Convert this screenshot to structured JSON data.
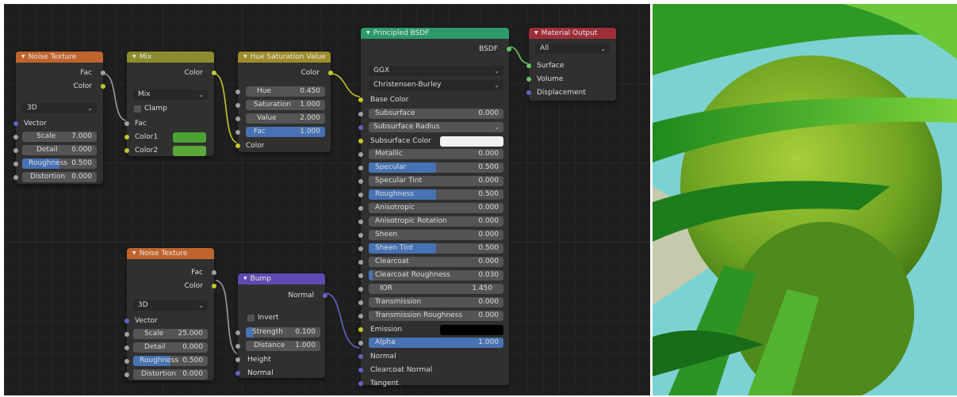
{
  "noise1": {
    "title": "Noise Texture",
    "out_fac": "Fac",
    "out_color": "Color",
    "dimensions": "3D",
    "in_vector": "Vector",
    "scale": {
      "label": "Scale",
      "value": "7.000"
    },
    "detail": {
      "label": "Detail",
      "value": "0.000"
    },
    "roughness": {
      "label": "Roughness",
      "value": "0.500",
      "fraction": 0.5
    },
    "distortion": {
      "label": "Distortion",
      "value": "0.000"
    }
  },
  "mix": {
    "title": "Mix",
    "out_color": "Color",
    "blend": "Mix",
    "clamp": "Clamp",
    "in_fac": "Fac",
    "color1": "Color1",
    "color2": "Color2",
    "color1_hex": "#4aa332",
    "color2_hex": "#5aa83a"
  },
  "hsv": {
    "title": "Hue Saturation Value",
    "out_color": "Color",
    "hue": {
      "label": "Hue",
      "value": "0.450"
    },
    "saturation": {
      "label": "Saturation",
      "value": "1.000"
    },
    "value": {
      "label": "Value",
      "value": "2.000"
    },
    "fac": {
      "label": "Fac",
      "value": "1.000",
      "fraction": 1.0
    },
    "in_color": "Color"
  },
  "bsdf": {
    "title": "Principled BSDF",
    "out_bsdf": "BSDF",
    "distribution": "GGX",
    "subsurface_method": "Christensen-Burley",
    "base_color": "Base Color",
    "subsurface": {
      "label": "Subsurface",
      "value": "0.000"
    },
    "subsurface_radius": "Subsurface Radius",
    "subsurface_color": "Subsurface Color",
    "metallic": {
      "label": "Metallic",
      "value": "0.000"
    },
    "specular": {
      "label": "Specular",
      "value": "0.500",
      "fraction": 0.5
    },
    "specular_tint": {
      "label": "Specular Tint",
      "value": "0.000"
    },
    "roughness": {
      "label": "Roughness",
      "value": "0.500",
      "fraction": 0.5
    },
    "anisotropic": {
      "label": "Anisotropic",
      "value": "0.000"
    },
    "anisotropic_rotation": {
      "label": "Anisotropic Rotation",
      "value": "0.000"
    },
    "sheen": {
      "label": "Sheen",
      "value": "0.000"
    },
    "sheen_tint": {
      "label": "Sheen Tint",
      "value": "0.500",
      "fraction": 0.5
    },
    "clearcoat": {
      "label": "Clearcoat",
      "value": "0.000"
    },
    "clearcoat_roughness": {
      "label": "Clearcoat Roughness",
      "value": "0.030",
      "fraction": 0.03
    },
    "ior": {
      "label": "IOR",
      "value": "1.450"
    },
    "transmission": {
      "label": "Transmission",
      "value": "0.000"
    },
    "transmission_roughness": {
      "label": "Transmission Roughness",
      "value": "0.000"
    },
    "emission": "Emission",
    "alpha": {
      "label": "Alpha",
      "value": "1.000",
      "fraction": 1.0
    },
    "normal": "Normal",
    "clearcoat_normal": "Clearcoat Normal",
    "tangent": "Tangent",
    "subsurface_color_hex": "#f2f2f2",
    "emission_color_hex": "#000000"
  },
  "output": {
    "title": "Material Output",
    "target": "All",
    "surface": "Surface",
    "volume": "Volume",
    "displacement": "Displacement"
  },
  "noise2": {
    "title": "Noise Texture",
    "out_fac": "Fac",
    "out_color": "Color",
    "dimensions": "3D",
    "in_vector": "Vector",
    "scale": {
      "label": "Scale",
      "value": "25.000"
    },
    "detail": {
      "label": "Detail",
      "value": "0.000"
    },
    "roughness": {
      "label": "Roughness",
      "value": "0.500",
      "fraction": 0.5
    },
    "distortion": {
      "label": "Distortion",
      "value": "0.000"
    }
  },
  "bump": {
    "title": "Bump",
    "out_normal": "Normal",
    "invert": "Invert",
    "strength": {
      "label": "Strength",
      "value": "0.100",
      "fraction": 0.1
    },
    "distance": {
      "label": "Distance",
      "value": "1.000"
    },
    "in_height": "Height",
    "in_normal": "Normal"
  },
  "icons": {
    "collapse": "triangle-down-icon",
    "dropdown": "chevron-down-icon"
  },
  "colors": {
    "texture_header": "#c0642e",
    "shader_header": "#2d9a6a",
    "output_header": "#9e2f38",
    "vector_header": "#6049b0",
    "slider_fill": "#4772b3"
  }
}
